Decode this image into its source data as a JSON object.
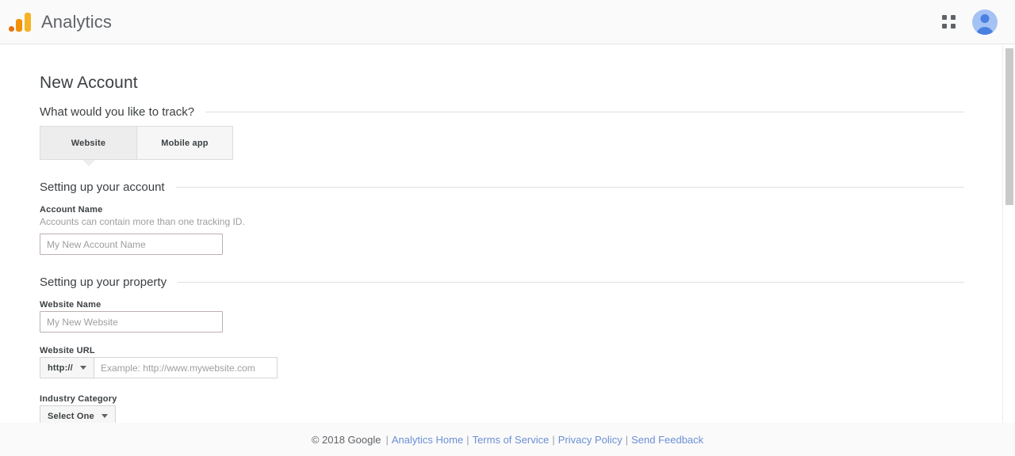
{
  "appbar": {
    "brand_title": "Analytics",
    "logo_icon": "analytics-bars-icon",
    "apps_icon": "apps-grid-icon",
    "avatar_icon": "user-avatar-icon"
  },
  "page": {
    "title": "New Account"
  },
  "track_section": {
    "heading": "What would you like to track?",
    "tabs": [
      {
        "label": "Website",
        "selected": true
      },
      {
        "label": "Mobile app",
        "selected": false
      }
    ]
  },
  "account_section": {
    "heading": "Setting up your account",
    "account_name": {
      "label": "Account Name",
      "help": "Accounts can contain more than one tracking ID.",
      "value": "",
      "placeholder": "My New Account Name"
    }
  },
  "property_section": {
    "heading": "Setting up your property",
    "website_name": {
      "label": "Website Name",
      "value": "",
      "placeholder": "My New Website"
    },
    "website_url": {
      "label": "Website URL",
      "protocol": "http://",
      "value": "",
      "placeholder": "Example: http://www.mywebsite.com"
    },
    "industry_category": {
      "label": "Industry Category",
      "selected": "Select One"
    }
  },
  "footer": {
    "copyright": "© 2018 Google",
    "separator": "|",
    "links": [
      {
        "label": "Analytics Home"
      },
      {
        "label": "Terms of Service"
      },
      {
        "label": "Privacy Policy"
      },
      {
        "label": "Send Feedback"
      }
    ]
  },
  "colors": {
    "logo_orange_dark": "#e8710a",
    "logo_orange": "#f09107",
    "logo_amber": "#f5b324",
    "link_blue": "#6c8fd6",
    "avatar_blue": "#a4c2f4"
  }
}
